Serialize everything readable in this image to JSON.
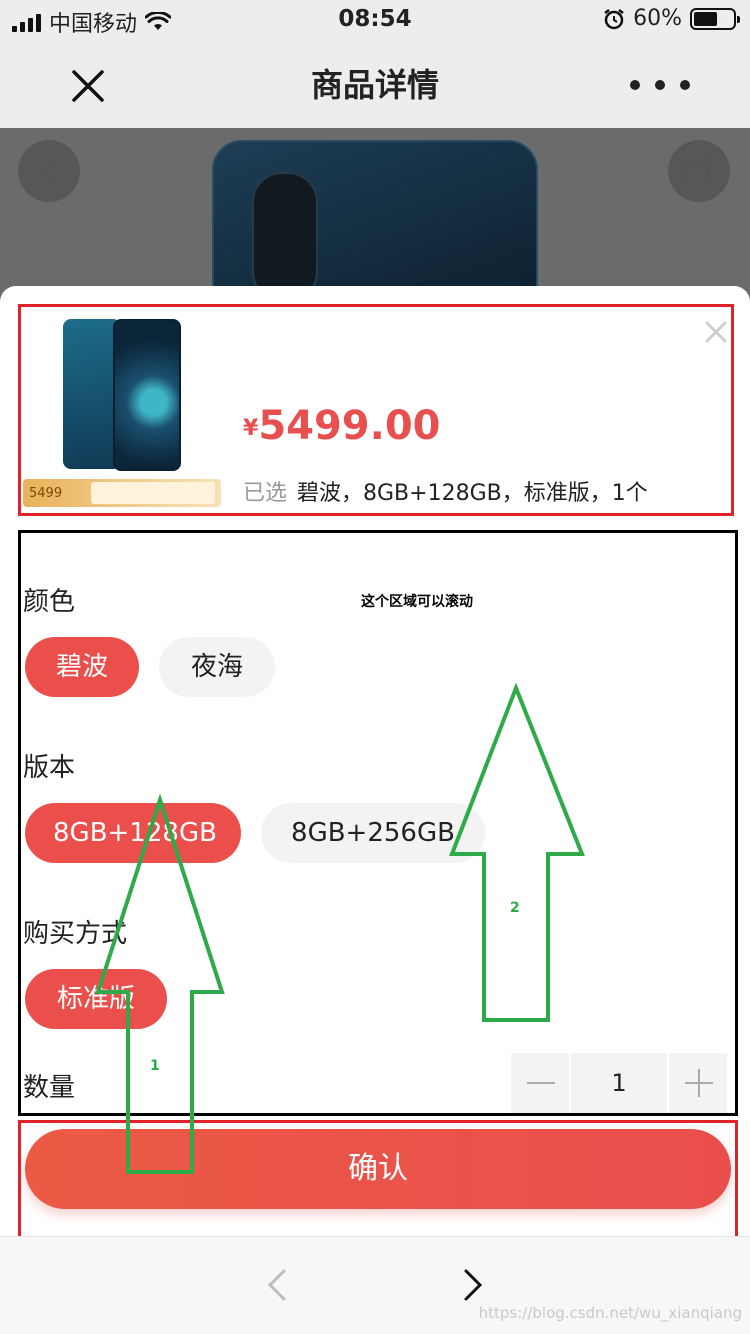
{
  "status_bar": {
    "carrier": "中国移动",
    "time": "08:54",
    "battery": "60%",
    "battery_level": 0.6
  },
  "navbar": {
    "title": "商品详情"
  },
  "product": {
    "price_symbol": "¥",
    "price": "5499.00",
    "banner_price": "5499",
    "selected_label": "已选",
    "selected_value": "碧波，8GB+128GB，标准版，1个"
  },
  "scroll_note": "这个区域可以滚动",
  "sections": {
    "color": {
      "label": "颜色",
      "options": [
        "碧波",
        "夜海"
      ],
      "selected": "碧波"
    },
    "version": {
      "label": "版本",
      "options": [
        "8GB+128GB",
        "8GB+256GB"
      ],
      "selected": "8GB+128GB"
    },
    "purchase": {
      "label": "购买方式",
      "options": [
        "标准版"
      ],
      "selected": "标准版"
    },
    "quantity": {
      "label": "数量",
      "value": "1"
    }
  },
  "confirm_label": "确认",
  "annotations": {
    "arrow1": "1",
    "arrow2": "2",
    "arrow_color": "#2eaa48"
  },
  "watermark": "https://blog.csdn.net/wu_xianqiang",
  "colors": {
    "accent": "#e8504f",
    "frame_red": "#e02329"
  }
}
